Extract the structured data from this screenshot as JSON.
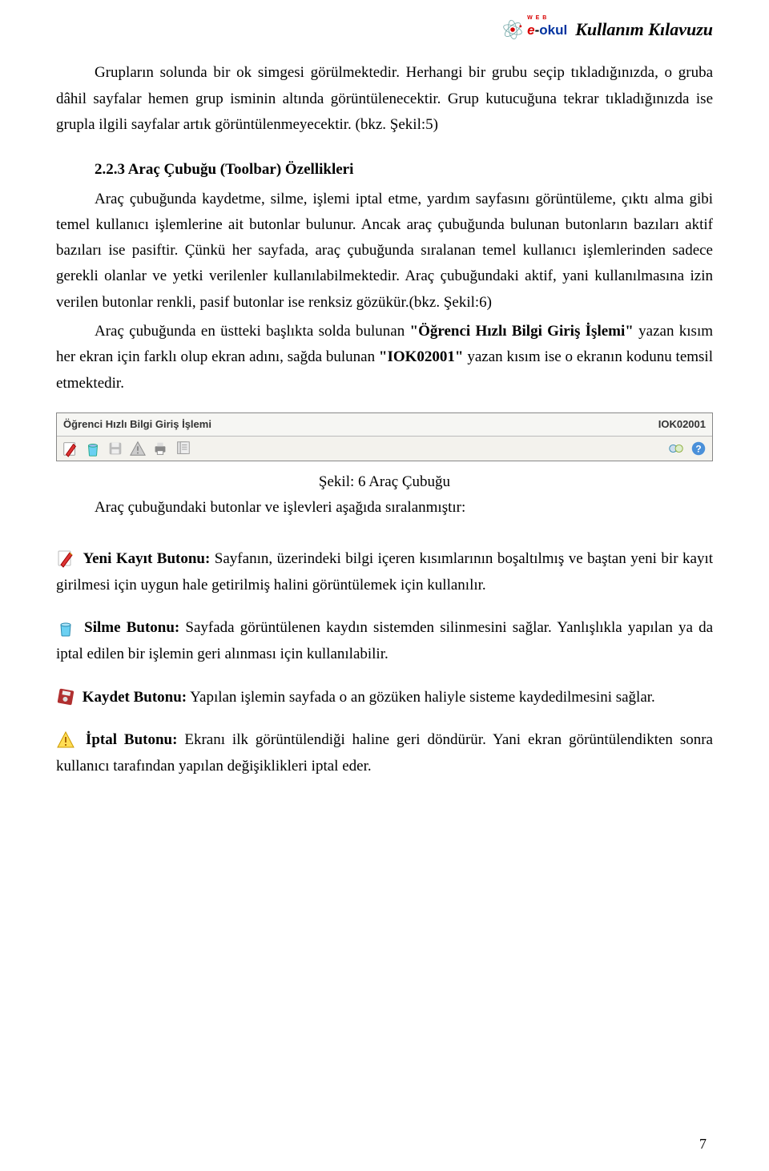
{
  "header": {
    "logo_text_e": "e",
    "logo_text_dash": "-",
    "logo_text_okul": "okul",
    "logo_subtext": "W E B",
    "title": "Kullanım Kılavuzu"
  },
  "body": {
    "p1": "Grupların solunda bir ok simgesi görülmektedir. Herhangi bir grubu seçip tıkladığınızda, o gruba dâhil sayfalar hemen grup isminin altında görüntülenecektir. Grup kutucuğuna tekrar tıkladığınızda ise grupla ilgili sayfalar artık görüntülenmeyecektir. (bkz. Şekil:5)",
    "h1": "2.2.3 Araç Çubuğu (Toolbar) Özellikleri",
    "p2a": "Araç çubuğunda kaydetme, silme, işlemi iptal etme, yardım sayfasını görüntüleme, çıktı alma gibi temel kullanıcı işlemlerine ait butonlar bulunur. Ancak araç çubuğunda bulunan butonların bazıları aktif bazıları ise pasiftir. Çünkü her sayfada, araç çubuğunda sıralanan temel kullanıcı işlemlerinden sadece gerekli olanlar ve yetki verilenler kullanılabilmektedir. Araç çubuğundaki aktif, yani kullanılmasına izin verilen butonlar renkli, pasif butonlar ise renksiz gözükür.(bkz. Şekil:6)",
    "p2b_pre": "Araç çubuğunda en üstteki başlıkta solda bulunan ",
    "p2b_bold1": "\"Öğrenci Hızlı Bilgi Giriş İşlemi\"",
    "p2b_mid": " yazan kısım her ekran için farklı olup ekran adını, sağda bulunan ",
    "p2b_bold2": "\"IOK02001\"",
    "p2b_post": " yazan kısım ise o ekranın kodunu temsil etmektedir."
  },
  "toolbar": {
    "title_left": "Öğrenci Hızlı Bilgi Giriş İşlemi",
    "title_right": "IOK02001",
    "icons_left": [
      "edit-icon",
      "trash-icon",
      "save-icon",
      "warning-icon",
      "print-icon",
      "report-icon"
    ],
    "icons_right": [
      "link-icon",
      "help-icon"
    ]
  },
  "caption": "Şekil: 6 Araç Çubuğu",
  "sub_caption": "Araç çubuğundaki butonlar ve işlevleri aşağıda sıralanmıştır:",
  "buttons": {
    "b1_title": "Yeni Kayıt Butonu:",
    "b1_text": "  Sayfanın, üzerindeki bilgi içeren kısımlarının boşaltılmış ve baştan yeni bir kayıt girilmesi için uygun hale getirilmiş halini görüntülemek için kullanılır.",
    "b2_title": "Silme Butonu:",
    "b2_text": " Sayfada görüntülenen kaydın sistemden silinmesini sağlar. Yanlışlıkla yapılan ya da iptal edilen bir işlemin geri alınması için kullanılabilir.",
    "b3_title": "Kaydet Butonu:",
    "b3_text": " Yapılan işlemin sayfada o an gözüken haliyle sisteme kaydedilmesini sağlar.",
    "b4_title": "İptal Butonu:",
    "b4_text": " Ekranı ilk görüntülendiği haline geri döndürür. Yani ekran görüntülendikten sonra kullanıcı tarafından yapılan değişiklikleri iptal eder."
  },
  "page_number": "7"
}
